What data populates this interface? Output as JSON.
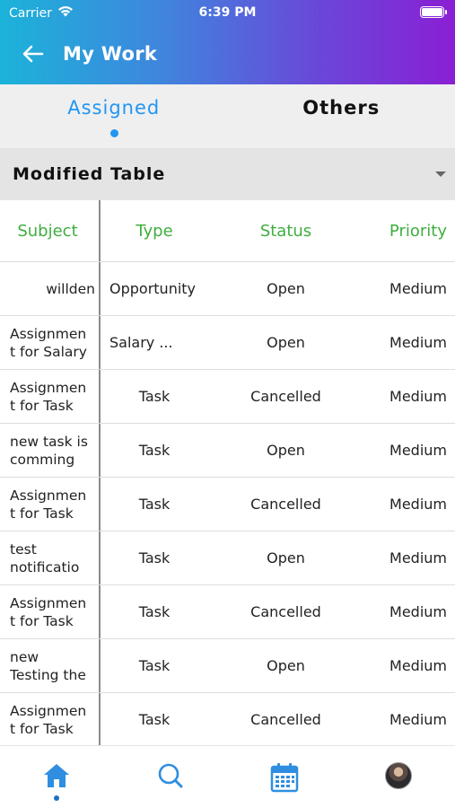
{
  "status_bar": {
    "carrier": "Carrier",
    "time": "6:39 PM"
  },
  "app_bar": {
    "title": "My Work",
    "back_icon": "arrow-left-icon"
  },
  "tabs": [
    {
      "label": "Assigned",
      "active": true
    },
    {
      "label": "Others",
      "active": false
    }
  ],
  "dropdown": {
    "selected": "Modified Table"
  },
  "table": {
    "headers": {
      "subject": "Subject",
      "type": "Type",
      "status": "Status",
      "priority": "Priority"
    },
    "rows": [
      {
        "subject": "willden",
        "type": "Opportunity",
        "status": "Open",
        "priority": "Medium"
      },
      {
        "subject": "Assignmen\nt for Salary",
        "type": "Salary ...",
        "status": "Open",
        "priority": "Medium"
      },
      {
        "subject": "Assignmen\nt for Task",
        "type": "Task",
        "status": "Cancelled",
        "priority": "Medium"
      },
      {
        "subject": "new task is\ncomming",
        "type": "Task",
        "status": "Open",
        "priority": "Medium"
      },
      {
        "subject": "Assignmen\nt for Task",
        "type": "Task",
        "status": "Cancelled",
        "priority": "Medium"
      },
      {
        "subject": "test\nnotificatio",
        "type": "Task",
        "status": "Open",
        "priority": "Medium"
      },
      {
        "subject": "Assignmen\nt for Task",
        "type": "Task",
        "status": "Cancelled",
        "priority": "Medium"
      },
      {
        "subject": "new\nTesting the",
        "type": "Task",
        "status": "Open",
        "priority": "Medium"
      },
      {
        "subject": "Assignmen\nt for Task",
        "type": "Task",
        "status": "Cancelled",
        "priority": "Medium"
      }
    ]
  },
  "bottom_nav": [
    {
      "icon": "home-icon",
      "active": true
    },
    {
      "icon": "search-icon",
      "active": false
    },
    {
      "icon": "calendar-icon",
      "active": false
    },
    {
      "icon": "profile-avatar",
      "active": false
    }
  ],
  "colors": {
    "header_gradient": [
      "#1bb3d9",
      "#8a1fd4"
    ],
    "accent": "#2196f3",
    "column_header": "#3fae3f"
  }
}
